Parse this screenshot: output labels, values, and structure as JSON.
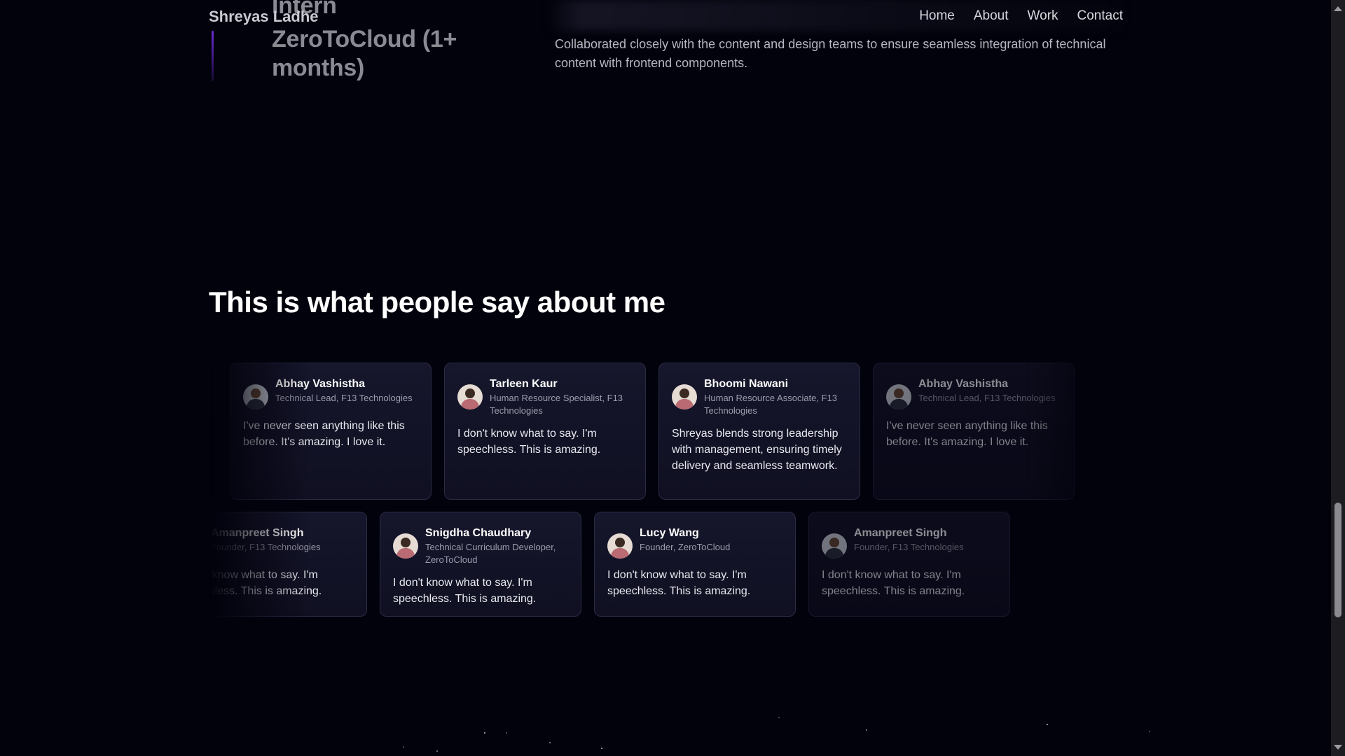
{
  "nav": {
    "brand": "Shreyas Ladhe",
    "links": [
      "Home",
      "About",
      "Work",
      "Contact"
    ]
  },
  "experience": {
    "role": "Intern",
    "company": "ZeroToCloud (1+ months)",
    "description": "Collaborated closely with the content and design teams to ensure seamless integration of technical content with frontend components."
  },
  "testimonials": {
    "title": "This is what people say about me",
    "row1": [
      {
        "name": "Bhoomi Nawani",
        "role": "Human Resource Associate, F13 Technologies",
        "quote": "Shreyas blends strong leadership with management, ensuring timely delivery and seamless teamwork.",
        "avatar_icon": "woman-avatar-icon",
        "visibility": "partial-left"
      },
      {
        "name": "Abhay Vashistha",
        "role": "Technical Lead, F13 Technologies",
        "quote": "I've never seen anything like this before. It's amazing. I love it.",
        "avatar_icon": "man-avatar-icon",
        "visibility": "full"
      },
      {
        "name": "Tarleen Kaur",
        "role": "Human Resource Specialist, F13 Technologies",
        "quote": "I don't know what to say. I'm speechless. This is amazing.",
        "avatar_icon": "woman-avatar-icon",
        "visibility": "full"
      },
      {
        "name": "Bhoomi Nawani",
        "role": "Human Resource Associate, F13 Technologies",
        "quote": "Shreyas blends strong leadership with management, ensuring timely delivery and seamless teamwork.",
        "avatar_icon": "woman-avatar-icon",
        "visibility": "full"
      },
      {
        "name": "Abhay Vashistha",
        "role": "Technical Lead, F13 Technologies",
        "quote": "I've never seen anything like this before. It's amazing. I love it.",
        "avatar_icon": "man-avatar-icon",
        "visibility": "partial-right"
      }
    ],
    "row2": [
      {
        "name": "Lucy Wang",
        "role": "Founder, ZeroToCloud",
        "quote": "I don't know what to say. I'm speechless. This is amazing.",
        "avatar_icon": "woman-avatar-icon",
        "visibility": "partial-left"
      },
      {
        "name": "Amanpreet Singh",
        "role": "Founder, F13 Technologies",
        "quote": "I don't know what to say. I'm speechless. This is amazing.",
        "avatar_icon": "man-avatar-icon",
        "visibility": "full"
      },
      {
        "name": "Snigdha Chaudhary",
        "role": "Technical Curriculum Developer, ZeroToCloud",
        "quote": "I don't know what to say. I'm speechless. This is amazing.",
        "avatar_icon": "woman-avatar-icon",
        "visibility": "full"
      },
      {
        "name": "Lucy Wang",
        "role": "Founder, ZeroToCloud",
        "quote": "I don't know what to say. I'm speechless. This is amazing.",
        "avatar_icon": "woman-avatar-icon",
        "visibility": "full"
      },
      {
        "name": "Amanpreet Singh",
        "role": "Founder, F13 Technologies",
        "quote": "I don't know what to say. I'm speechless. This is amazing.",
        "avatar_icon": "man-avatar-icon",
        "visibility": "partial-right"
      }
    ]
  },
  "colors": {
    "background": "#02020c",
    "card": "#15152b",
    "card_border": "#2b2b48",
    "accent": "#6a2bd6"
  },
  "scrollbar": {
    "position_fraction": 0.76
  }
}
